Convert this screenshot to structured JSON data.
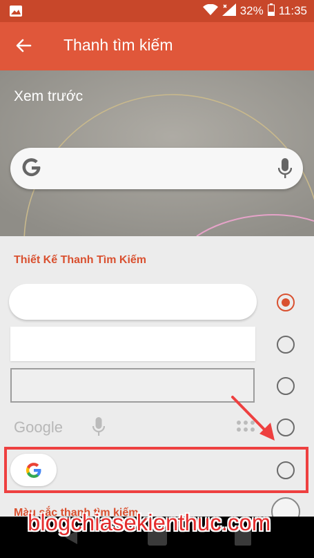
{
  "status_bar": {
    "battery": "32%",
    "time": "11:35",
    "icons": [
      "image-icon",
      "wifi-icon",
      "signal-icon",
      "battery-icon"
    ]
  },
  "app_bar": {
    "title": "Thanh tìm kiếm",
    "back_icon": "back-arrow-icon"
  },
  "preview": {
    "label": "Xem trước",
    "search_icons": [
      "google-g-icon",
      "mic-icon"
    ]
  },
  "design_section": {
    "title": "Thiết Kế Thanh Tìm Kiếm",
    "styles": [
      {
        "name": "rounded-white",
        "selected": true
      },
      {
        "name": "square-white",
        "selected": false
      },
      {
        "name": "outlined-gray",
        "selected": false
      },
      {
        "name": "transparent-google-text",
        "selected": false,
        "google_text": "Google"
      },
      {
        "name": "pill-google-logo",
        "selected": false
      }
    ]
  },
  "color_section": {
    "title": "Màu sắc thanh tìm kiếm"
  },
  "watermark": "blogchiasekienthuc.com",
  "colors": {
    "accent": "#d9502f",
    "app_bar": "#e0573a",
    "status_bar": "#c8472a",
    "highlight": "#ee4040"
  }
}
